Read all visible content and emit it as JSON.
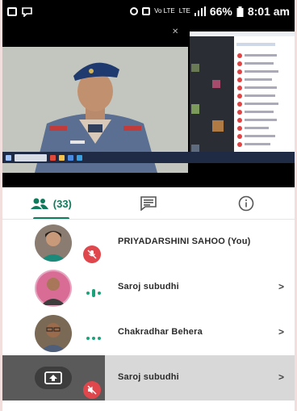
{
  "status_bar": {
    "battery": "66%",
    "time": "8:01 am",
    "network": "Vo LTE",
    "signal": "LTE"
  },
  "tabs": {
    "people_count": "(33)",
    "items": [
      "people",
      "chat",
      "info"
    ]
  },
  "participants": [
    {
      "name": "PRIYADARSHINI SAHOO (You)",
      "status": "mic-off",
      "avatar": "photo-woman"
    },
    {
      "name": "Saroj subudhi",
      "status": "speaking",
      "avatar": "photo-man-red"
    },
    {
      "name": "Chakradhar Behera",
      "status": "connecting",
      "avatar": "photo-man-glasses"
    },
    {
      "name": "Saroj subudhi",
      "status": "presenting-muted",
      "avatar": "present-screen-icon"
    }
  ],
  "colors": {
    "accent": "#0f7a5c",
    "muted_badge": "#e0474c",
    "status_bg": "#000000"
  }
}
